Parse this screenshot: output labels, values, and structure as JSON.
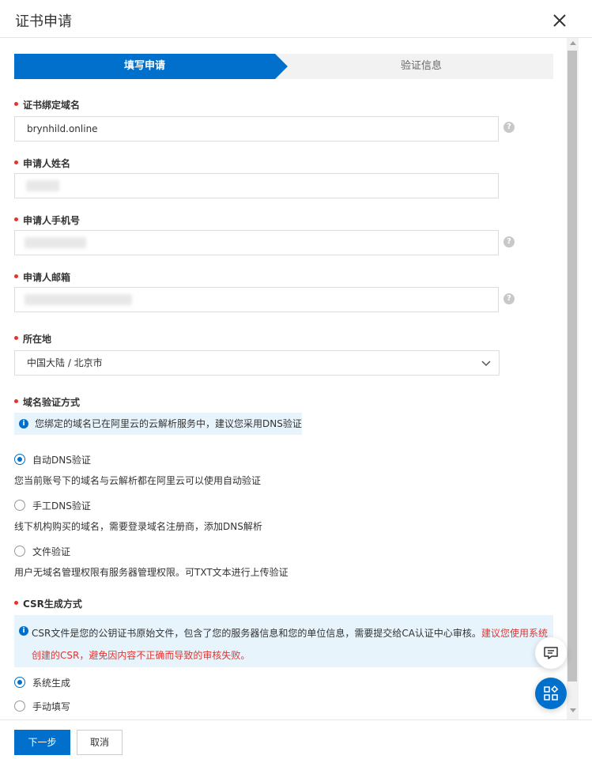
{
  "dialog": {
    "title": "证书申请"
  },
  "steps": [
    {
      "label": "填写申请",
      "active": true
    },
    {
      "label": "验证信息",
      "active": false
    }
  ],
  "fields": {
    "domain": {
      "label": "证书绑定域名",
      "value": "brynhild.online"
    },
    "name": {
      "label": "申请人姓名"
    },
    "phone": {
      "label": "申请人手机号"
    },
    "email": {
      "label": "申请人邮箱"
    },
    "location": {
      "label": "所在地",
      "value": "中国大陆 / 北京市"
    }
  },
  "verify": {
    "label": "域名验证方式",
    "info": "您绑定的域名已在阿里云的云解析服务中，建议您采用DNS验证",
    "options": [
      {
        "label": "自动DNS验证",
        "desc": "您当前账号下的域名与云解析都在阿里云可以使用自动验证",
        "selected": true
      },
      {
        "label": "手工DNS验证",
        "desc": "线下机构购买的域名，需要登录域名注册商，添加DNS解析",
        "selected": false
      },
      {
        "label": "文件验证",
        "desc": "用户无域名管理权限有服务器管理权限。可TXT文本进行上传验证",
        "selected": false
      }
    ]
  },
  "csr": {
    "label": "CSR生成方式",
    "info_normal": "CSR文件是您的公钥证书原始文件，包含了您的服务器信息和您的单位信息，需要提交给CA认证中心审核。",
    "info_warn_1": "建议您使用系统",
    "info_warn_2": "创建的CSR，避免因内容不正确而导致的审核失败。",
    "options": [
      {
        "label": "系统生成",
        "selected": true
      },
      {
        "label": "手动填写",
        "selected": false
      }
    ]
  },
  "footer": {
    "next": "下一步",
    "cancel": "取消"
  },
  "colors": {
    "primary": "#0070cc",
    "required": "#e3342f",
    "info_bg": "#e8f4fc"
  }
}
